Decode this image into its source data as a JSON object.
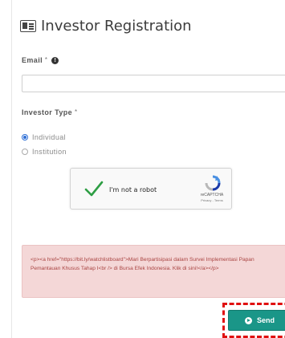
{
  "form": {
    "title": "Investor Registration",
    "title_icon": "id-card-icon",
    "email": {
      "label": "Email",
      "required_marker": "*",
      "info_icon": "info-icon",
      "value": "",
      "placeholder": ""
    },
    "investor_type": {
      "label": "Investor Type",
      "required_marker": "*",
      "options": [
        {
          "label": "Individual",
          "checked": true
        },
        {
          "label": "Institution",
          "checked": false
        }
      ]
    },
    "captcha": {
      "label": "I'm not a robot",
      "brand": "reCAPTCHA",
      "links": "Privacy - Terms",
      "checked": true,
      "check_color": "#2e9e44"
    },
    "alert": {
      "text": "<p><a href=\"https://bit.ly/watchlistboard\">Mari Berpartisipasi dalam Survei Implementasi Papan Pemantauan Khusus Tahap I<br /> di Bursa Efek Indonesia. Klik di sini!</a></p>",
      "background": "#f4d7d7",
      "text_color": "#a94442"
    },
    "send_button": {
      "label": "Send",
      "icon": "play-circle-icon",
      "color": "#1a9688",
      "highlight_color": "#e01010"
    }
  }
}
